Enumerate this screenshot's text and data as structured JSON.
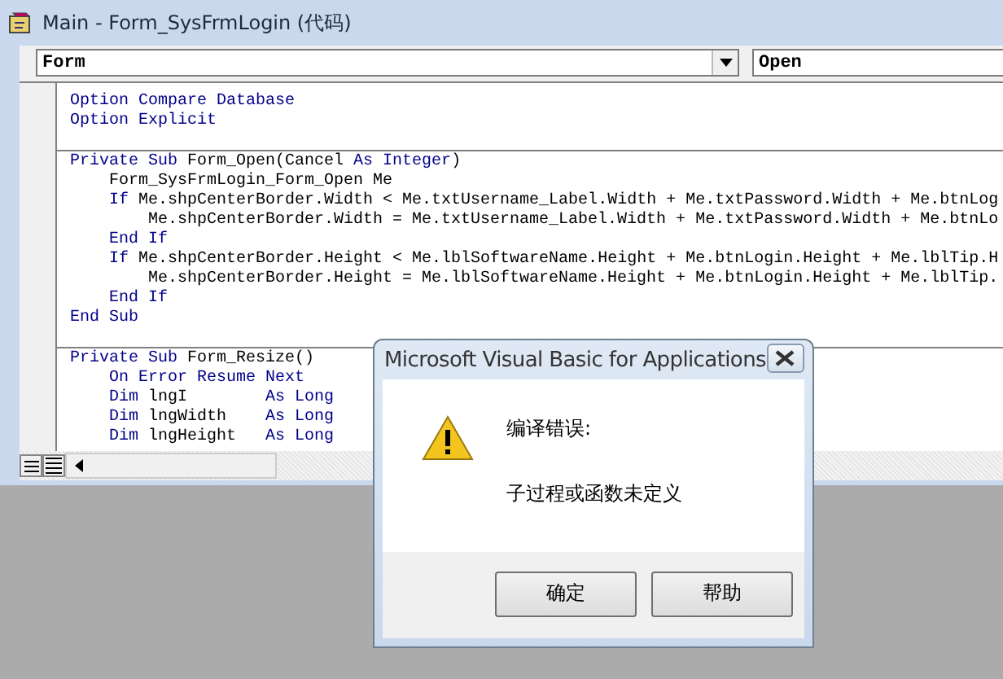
{
  "window": {
    "title": "Main - Form_SysFrmLogin (代码)"
  },
  "object_combo": {
    "value": "Form"
  },
  "procedure_combo": {
    "value": "Open"
  },
  "code_lines": [
    {
      "kind": "code",
      "segments": [
        {
          "text": "Option Compare Database",
          "kind": "keyword"
        }
      ]
    },
    {
      "kind": "code",
      "segments": [
        {
          "text": "Option Explicit",
          "kind": "keyword"
        }
      ]
    },
    {
      "kind": "divider"
    },
    {
      "kind": "code",
      "segments": [
        {
          "text": "Private Sub",
          "kind": "keyword"
        },
        {
          "text": " Form_Open(Cancel ",
          "kind": "plain"
        },
        {
          "text": "As Integer",
          "kind": "keyword"
        },
        {
          "text": ")",
          "kind": "plain"
        }
      ]
    },
    {
      "kind": "code",
      "segments": [
        {
          "text": "    Form_SysFrmLogin_Form_Open Me",
          "kind": "plain"
        }
      ]
    },
    {
      "kind": "code",
      "segments": [
        {
          "text": "    If",
          "kind": "keyword"
        },
        {
          "text": " Me.shpCenterBorder.Width < Me.txtUsername_Label.Width + Me.txtPassword.Width + Me.btnLog",
          "kind": "plain"
        }
      ]
    },
    {
      "kind": "code",
      "segments": [
        {
          "text": "        Me.shpCenterBorder.Width = Me.txtUsername_Label.Width + Me.txtPassword.Width + Me.btnLo",
          "kind": "plain"
        }
      ]
    },
    {
      "kind": "code",
      "segments": [
        {
          "text": "    End If",
          "kind": "keyword"
        }
      ]
    },
    {
      "kind": "code",
      "segments": [
        {
          "text": "    If",
          "kind": "keyword"
        },
        {
          "text": " Me.shpCenterBorder.Height < Me.lblSoftwareName.Height + Me.btnLogin.Height + Me.lblTip.H",
          "kind": "plain"
        }
      ]
    },
    {
      "kind": "code",
      "segments": [
        {
          "text": "        Me.shpCenterBorder.Height = Me.lblSoftwareName.Height + Me.btnLogin.Height + Me.lblTip.",
          "kind": "plain"
        }
      ]
    },
    {
      "kind": "code",
      "segments": [
        {
          "text": "    End If",
          "kind": "keyword"
        }
      ]
    },
    {
      "kind": "code",
      "segments": [
        {
          "text": "End Sub",
          "kind": "keyword"
        }
      ]
    },
    {
      "kind": "divider"
    },
    {
      "kind": "code",
      "segments": [
        {
          "text": "Private Sub",
          "kind": "keyword"
        },
        {
          "text": " Form_Resize()",
          "kind": "plain"
        }
      ]
    },
    {
      "kind": "code",
      "segments": [
        {
          "text": "    On Error Resume Next",
          "kind": "keyword"
        }
      ]
    },
    {
      "kind": "code",
      "segments": [
        {
          "text": "    Dim",
          "kind": "keyword"
        },
        {
          "text": " lngI        ",
          "kind": "plain"
        },
        {
          "text": "As Long",
          "kind": "keyword"
        }
      ]
    },
    {
      "kind": "code",
      "segments": [
        {
          "text": "    Dim",
          "kind": "keyword"
        },
        {
          "text": " lngWidth    ",
          "kind": "plain"
        },
        {
          "text": "As Long",
          "kind": "keyword"
        }
      ]
    },
    {
      "kind": "code",
      "segments": [
        {
          "text": "    Dim",
          "kind": "keyword"
        },
        {
          "text": " lngHeight   ",
          "kind": "plain"
        },
        {
          "text": "As Long",
          "kind": "keyword"
        }
      ]
    }
  ],
  "dialog": {
    "title": "Microsoft Visual Basic for Applications",
    "heading": "编译错误:",
    "message": "子过程或函数未定义",
    "buttons": [
      "确定",
      "帮助"
    ]
  }
}
